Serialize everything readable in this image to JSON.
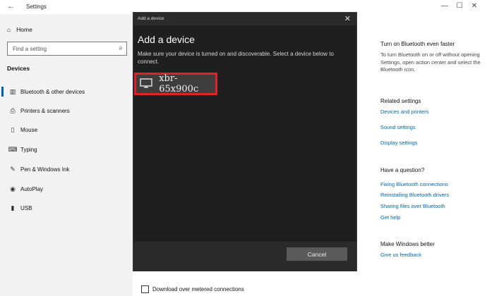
{
  "window": {
    "title": "Settings",
    "controls": [
      "—",
      "☐",
      "✕"
    ]
  },
  "sidebar": {
    "home_label": "Home",
    "search_placeholder": "Find a setting",
    "section_heading": "Devices",
    "items": [
      {
        "label": "Bluetooth & other devices",
        "icon": "bluetooth-icon"
      },
      {
        "label": "Printers & scanners",
        "icon": "printer-icon"
      },
      {
        "label": "Mouse",
        "icon": "mouse-icon"
      },
      {
        "label": "Typing",
        "icon": "keyboard-icon"
      },
      {
        "label": "Pen & Windows Ink",
        "icon": "pen-icon"
      },
      {
        "label": "AutoPlay",
        "icon": "autoplay-icon"
      },
      {
        "label": "USB",
        "icon": "usb-icon"
      }
    ]
  },
  "main": {
    "metered_label": "Download over metered connections"
  },
  "side_panel": {
    "faster_heading": "Turn on Bluetooth even faster",
    "faster_text": "To turn Bluetooth on or off without opening Settings, open action center and select the Bluetooth icon.",
    "related_heading": "Related settings",
    "related_links": [
      "Devices and printers",
      "Sound settings",
      "Display settings"
    ],
    "question_heading": "Have a question?",
    "question_links": [
      "Fixing Bluetooth connections",
      "Reinstalling Bluetooth drivers",
      "Sharing files over Bluetooth",
      "Get help"
    ],
    "better_heading": "Make Windows better",
    "feedback_link": "Give us feedback"
  },
  "dialog": {
    "small_title": "Add a device",
    "title": "Add a device",
    "description": "Make sure your device is turned on and discoverable. Select a device below to connect.",
    "device_name": "xbr-65x900c",
    "device_icon": "display-icon",
    "cancel_label": "Cancel",
    "selection_color": "#e0202a"
  }
}
